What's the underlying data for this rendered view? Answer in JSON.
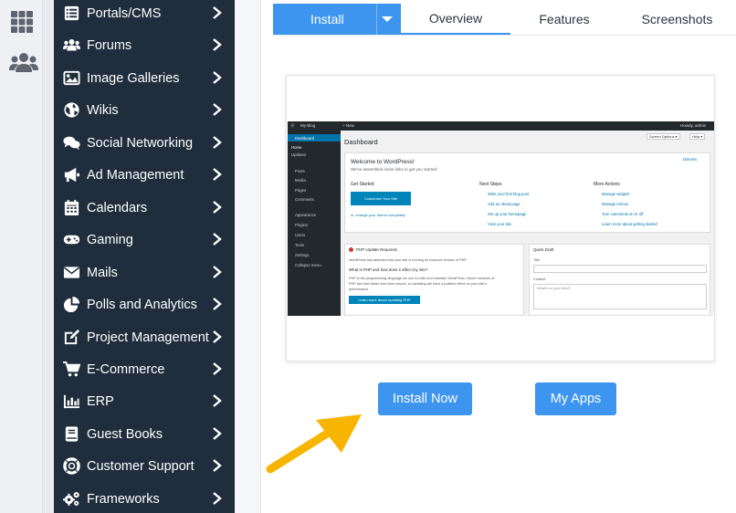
{
  "sidebar": {
    "items": [
      {
        "label": "Portals/CMS",
        "icon": "list-icon",
        "top": 0
      },
      {
        "label": "Forums",
        "icon": "users-icon"
      },
      {
        "label": "Image Galleries",
        "icon": "image-icon"
      },
      {
        "label": "Wikis",
        "icon": "globe-icon"
      },
      {
        "label": "Social Networking",
        "icon": "chat-icon"
      },
      {
        "label": "Ad Management",
        "icon": "megaphone-icon"
      },
      {
        "label": "Calendars",
        "icon": "calendar-icon"
      },
      {
        "label": "Gaming",
        "icon": "gamepad-icon"
      },
      {
        "label": "Mails",
        "icon": "envelope-icon"
      },
      {
        "label": "Polls and Analytics",
        "icon": "pie-chart-icon"
      },
      {
        "label": "Project Management",
        "icon": "edit-icon"
      },
      {
        "label": "E-Commerce",
        "icon": "cart-icon"
      },
      {
        "label": "ERP",
        "icon": "bar-chart-icon"
      },
      {
        "label": "Guest Books",
        "icon": "book-icon"
      },
      {
        "label": "Customer Support",
        "icon": "lifebuoy-icon"
      },
      {
        "label": "Frameworks",
        "icon": "cogs-icon"
      }
    ]
  },
  "tabs": {
    "install": "Install",
    "overview": "Overview",
    "features": "Features",
    "screenshots": "Screenshots"
  },
  "wp": {
    "bar_myblog": "My Blog",
    "bar_new": "+ New",
    "bar_howdy": "Howdy, admin",
    "screen_options": "Screen Options ▾",
    "help": "Help ▾",
    "menu": [
      "Dashboard",
      "Home",
      "Updates",
      "Posts",
      "Media",
      "Pages",
      "Comments",
      "Appearance",
      "Plugins",
      "Users",
      "Tools",
      "Settings",
      "Collapse menu"
    ],
    "title": "Dashboard",
    "welcome_title": "Welcome to WordPress!",
    "welcome_sub": "We've assembled some links to get you started:",
    "dismiss": "Dismiss",
    "get_started": "Get Started",
    "customize_btn": "Customize Your Site",
    "change_theme": "or, change your theme completely",
    "next_steps": "Next Steps",
    "next_items": [
      "Write your first blog post",
      "Add an About page",
      "Set up your homepage",
      "View your site"
    ],
    "more_actions": "More Actions",
    "more_items": [
      "Manage widgets",
      "Manage menus",
      "Turn comments on or off",
      "Learn more about getting started"
    ],
    "php_title": "PHP Update Required",
    "php_line1": "WordPress has detected that your site is running an insecure version of PHP.",
    "php_q": "What is PHP and how does it affect my site?",
    "php_line2": "PHP is the programming language we use to build and maintain WordPress. Newer versions of",
    "php_line3": "PHP are both faster and more secure, so updating will have a positive effect on your site's",
    "php_line4": "performance.",
    "php_btn": "Learn more about updating PHP",
    "qd_title": "Quick Draft",
    "qd_title_label": "Title",
    "qd_content_label": "Content",
    "qd_placeholder": "What's on your mind?"
  },
  "actions": {
    "install_now": "Install Now",
    "my_apps": "My Apps"
  },
  "colors": {
    "accent": "#3d95f0",
    "sidebar_bg": "#1f2d3d",
    "arrow": "#f7b500"
  }
}
